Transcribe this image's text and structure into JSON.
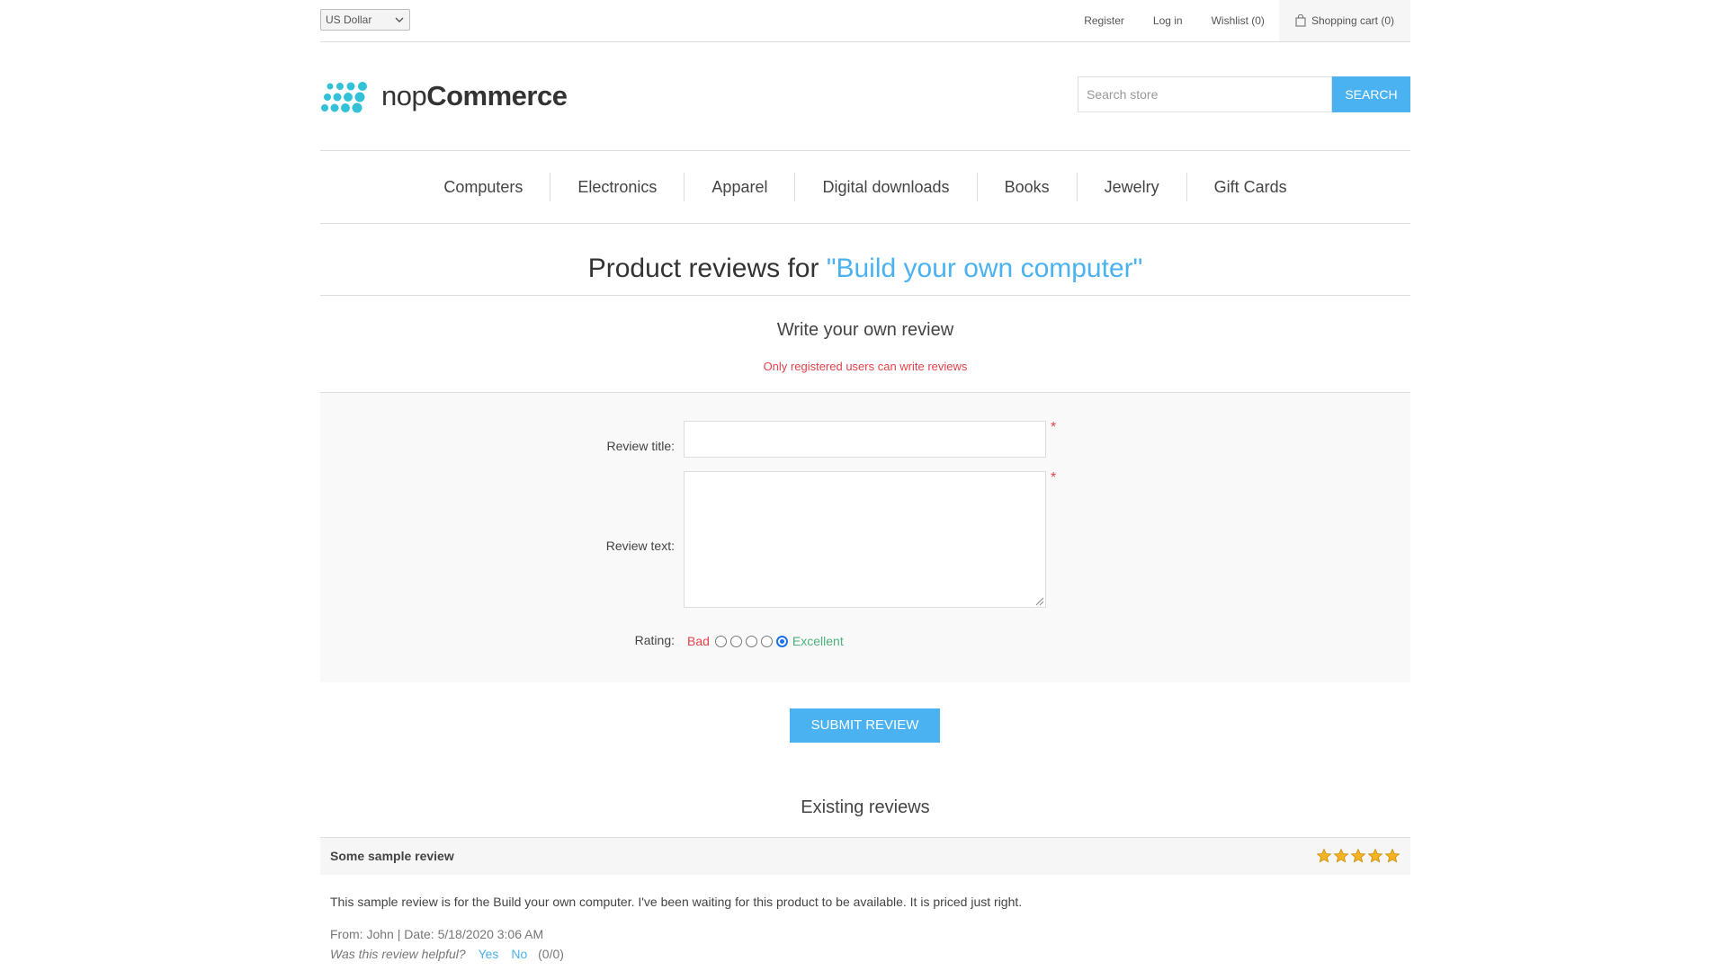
{
  "header": {
    "currency": "US Dollar",
    "links": [
      "Register",
      "Log in",
      "Wishlist (0)"
    ],
    "cart": "Shopping cart (0)"
  },
  "logo": {
    "text_light": "nop",
    "text_bold": "Commerce"
  },
  "search": {
    "placeholder": "Search store",
    "button": "SEARCH"
  },
  "menu": [
    "Computers",
    "Electronics",
    "Apparel",
    "Digital downloads",
    "Books",
    "Jewelry",
    "Gift Cards"
  ],
  "page": {
    "title_prefix": "Product reviews for ",
    "product_name": "\"Build your own computer\"",
    "write_title": "Write your own review",
    "notice": "Only registered users can write reviews"
  },
  "form": {
    "review_title_label": "Review title:",
    "review_text_label": "Review text:",
    "rating_label": "Rating:",
    "rating_bad": "Bad",
    "rating_excellent": "Excellent",
    "selected_rating": 5,
    "required_mark": "*",
    "submit": "SUBMIT REVIEW"
  },
  "existing": {
    "title": "Existing reviews",
    "reviews": [
      {
        "title": "Some sample review",
        "stars": 5,
        "text": "This sample review is for the Build your own computer. I've been waiting for this product to be available. It is priced just right.",
        "info": "From: John | Date: 5/18/2020 3:06 AM",
        "helpful_question": "Was this review helpful?",
        "yes": "Yes",
        "no": "No",
        "counts": "(0/0)"
      }
    ]
  },
  "colors": {
    "accent": "#4ab2f1",
    "error": "#e4434b",
    "success": "#4cb17c",
    "star": "#f5b324"
  }
}
